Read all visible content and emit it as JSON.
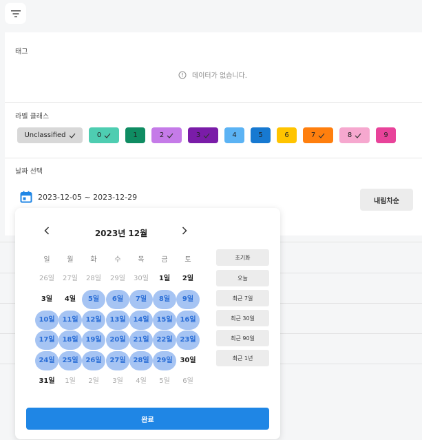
{
  "filter": {
    "icon": "filter-lines-icon"
  },
  "tags": {
    "label": "태그",
    "empty_text": "데이터가 없습니다."
  },
  "label_classes": {
    "label": "라벨 클래스",
    "chips": [
      {
        "name": "Unclassified",
        "checked": true,
        "color": "#d8d8d8"
      },
      {
        "name": "0",
        "checked": true,
        "color": "#4ecdb1"
      },
      {
        "name": "1",
        "checked": false,
        "color": "#0f8c62"
      },
      {
        "name": "2",
        "checked": true,
        "color": "#c57be8"
      },
      {
        "name": "3",
        "checked": true,
        "color": "#7a1ca8"
      },
      {
        "name": "4",
        "checked": false,
        "color": "#5bb3f4"
      },
      {
        "name": "5",
        "checked": false,
        "color": "#1779d1"
      },
      {
        "name": "6",
        "checked": false,
        "color": "#ffc400"
      },
      {
        "name": "7",
        "checked": true,
        "color": "#ff7f0e"
      },
      {
        "name": "8",
        "checked": true,
        "color": "#f6a8cf"
      },
      {
        "name": "9",
        "checked": false,
        "color": "#e8439a"
      }
    ]
  },
  "date": {
    "label": "날짜 선택",
    "range": "2023-12-05 ~ 2023-12-29",
    "sort_label": "내림차순",
    "icon_color": "#1f86e5"
  },
  "calendar": {
    "month": "2023년 12월",
    "weekdays": [
      "일",
      "월",
      "화",
      "수",
      "목",
      "금",
      "토"
    ],
    "weeks": [
      [
        {
          "t": "26일",
          "s": "muted"
        },
        {
          "t": "27일",
          "s": "muted"
        },
        {
          "t": "28일",
          "s": "muted"
        },
        {
          "t": "29일",
          "s": "muted"
        },
        {
          "t": "30일",
          "s": "muted"
        },
        {
          "t": "1일",
          "s": ""
        },
        {
          "t": "2일",
          "s": ""
        }
      ],
      [
        {
          "t": "3일",
          "s": ""
        },
        {
          "t": "4일",
          "s": ""
        },
        {
          "t": "5일",
          "s": "sel"
        },
        {
          "t": "6일",
          "s": "sel"
        },
        {
          "t": "7일",
          "s": "sel"
        },
        {
          "t": "8일",
          "s": "sel"
        },
        {
          "t": "9일",
          "s": "sel"
        }
      ],
      [
        {
          "t": "10일",
          "s": "sel"
        },
        {
          "t": "11일",
          "s": "sel"
        },
        {
          "t": "12일",
          "s": "sel"
        },
        {
          "t": "13일",
          "s": "sel"
        },
        {
          "t": "14일",
          "s": "sel"
        },
        {
          "t": "15일",
          "s": "sel"
        },
        {
          "t": "16일",
          "s": "sel"
        }
      ],
      [
        {
          "t": "17일",
          "s": "sel"
        },
        {
          "t": "18일",
          "s": "sel"
        },
        {
          "t": "19일",
          "s": "sel"
        },
        {
          "t": "20일",
          "s": "sel"
        },
        {
          "t": "21일",
          "s": "sel"
        },
        {
          "t": "22일",
          "s": "sel"
        },
        {
          "t": "23일",
          "s": "sel"
        }
      ],
      [
        {
          "t": "24일",
          "s": "sel"
        },
        {
          "t": "25일",
          "s": "sel"
        },
        {
          "t": "26일",
          "s": "sel"
        },
        {
          "t": "27일",
          "s": "sel"
        },
        {
          "t": "28일",
          "s": "sel"
        },
        {
          "t": "29일",
          "s": "sel"
        },
        {
          "t": "30일",
          "s": ""
        }
      ],
      [
        {
          "t": "31일",
          "s": ""
        },
        {
          "t": "1일",
          "s": "muted"
        },
        {
          "t": "2일",
          "s": "muted"
        },
        {
          "t": "3일",
          "s": "muted"
        },
        {
          "t": "4일",
          "s": "muted"
        },
        {
          "t": "5일",
          "s": "muted"
        },
        {
          "t": "6일",
          "s": "muted"
        }
      ]
    ],
    "presets": [
      "초기화",
      "오늘",
      "최근 7일",
      "최근 30일",
      "최근 90일",
      "최근 1년"
    ],
    "done_label": "완료",
    "selected_color": "#a6c4f3",
    "selected_text_color": "#2b6ed6",
    "accent": "#1f86e5"
  }
}
